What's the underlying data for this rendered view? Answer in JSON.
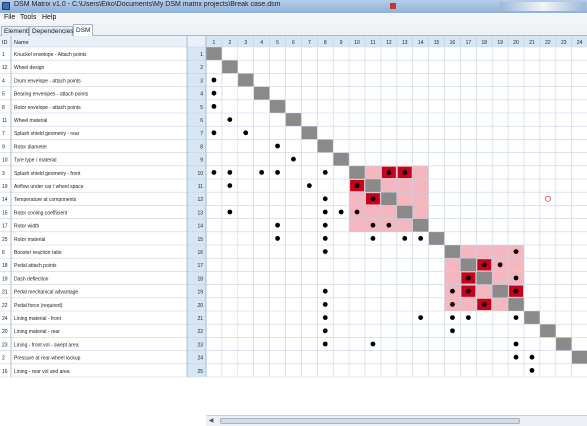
{
  "window": {
    "title": "DSM Matrix v1.0 - C:\\Users\\Eiko\\Documents\\My DSM matrix projects\\Break case.dsm"
  },
  "menu": [
    "File",
    "Tools",
    "Help"
  ],
  "tabs": [
    {
      "label": "Elements",
      "active": false
    },
    {
      "label": "Dependencies",
      "active": false
    },
    {
      "label": "DSM",
      "active": true
    }
  ],
  "table_header": {
    "id": "ID",
    "name": "Name"
  },
  "rows": [
    {
      "id": "1",
      "name": "Knuckel envelope - Attach points",
      "index": "1"
    },
    {
      "id": "12",
      "name": "Wheel design",
      "index": "2"
    },
    {
      "id": "4",
      "name": "Drum envelope - attach points",
      "index": "3"
    },
    {
      "id": "5",
      "name": "Bearing envelopes - attach points",
      "index": "4"
    },
    {
      "id": "8",
      "name": "Rotor envelope - attach points",
      "index": "5"
    },
    {
      "id": "11",
      "name": "Wheel material",
      "index": "6"
    },
    {
      "id": "7",
      "name": "Splash shield geometry - rear",
      "index": "7"
    },
    {
      "id": "9",
      "name": "Rotor diameter",
      "index": "8"
    },
    {
      "id": "10",
      "name": "Tyre type / material",
      "index": "9"
    },
    {
      "id": "3",
      "name": "Splash shield geometry - front",
      "index": "10"
    },
    {
      "id": "19",
      "name": "Airflow under car / wheel space",
      "index": "11"
    },
    {
      "id": "14",
      "name": "Temperature at components",
      "index": "12"
    },
    {
      "id": "15",
      "name": "Rotor cooling coefficient",
      "index": "13"
    },
    {
      "id": "17",
      "name": "Rotor width",
      "index": "14"
    },
    {
      "id": "25",
      "name": "Rotor material",
      "index": "15"
    },
    {
      "id": "6",
      "name": "Booster reaction ratio",
      "index": "16"
    },
    {
      "id": "18",
      "name": "Pedal attach points",
      "index": "17"
    },
    {
      "id": "19",
      "name": "Dash deflection",
      "index": "18"
    },
    {
      "id": "21",
      "name": "Pedal mechanical advantage",
      "index": "19"
    },
    {
      "id": "22",
      "name": "Pedal force (required)",
      "index": "20"
    },
    {
      "id": "24",
      "name": "Lining material - front",
      "index": "21"
    },
    {
      "id": "20",
      "name": "Lining material - rear",
      "index": "22"
    },
    {
      "id": "23",
      "name": "Lining - front vol - swept area",
      "index": "23"
    },
    {
      "id": "2",
      "name": "Pressure at rear-wheel lockup",
      "index": "24"
    },
    {
      "id": "16",
      "name": "Lining - rear vol and area",
      "index": "25"
    }
  ],
  "column_headers": [
    "1",
    "2",
    "3",
    "4",
    "5",
    "6",
    "7",
    "8",
    "9",
    "10",
    "11",
    "12",
    "13",
    "14",
    "15",
    "16",
    "17",
    "18",
    "19",
    "20",
    "21",
    "22",
    "23",
    "24"
  ],
  "matrix": {
    "dependencies": [
      [
        3,
        1
      ],
      [
        4,
        1
      ],
      [
        5,
        1
      ],
      [
        6,
        2
      ],
      [
        7,
        1
      ],
      [
        7,
        3
      ],
      [
        8,
        5
      ],
      [
        9,
        6
      ],
      [
        10,
        1
      ],
      [
        10,
        2
      ],
      [
        10,
        4
      ],
      [
        10,
        5
      ],
      [
        10,
        8
      ],
      [
        11,
        2
      ],
      [
        11,
        7
      ],
      [
        12,
        8
      ],
      [
        13,
        2
      ],
      [
        13,
        8
      ],
      [
        13,
        9
      ],
      [
        14,
        5
      ],
      [
        14,
        8
      ],
      [
        15,
        5
      ],
      [
        15,
        8
      ],
      [
        16,
        8
      ],
      [
        19,
        8
      ],
      [
        20,
        8
      ],
      [
        21,
        8
      ],
      [
        21,
        14
      ],
      [
        22,
        8
      ],
      [
        23,
        8
      ],
      [
        23,
        11
      ],
      [
        24,
        21
      ],
      [
        25,
        21
      ],
      [
        12,
        11
      ],
      [
        14,
        11
      ],
      [
        15,
        11
      ],
      [
        15,
        13
      ],
      [
        14,
        12
      ],
      [
        15,
        14
      ],
      [
        13,
        10
      ],
      [
        19,
        16
      ],
      [
        19,
        19
      ],
      [
        20,
        16
      ],
      [
        21,
        16
      ],
      [
        22,
        16
      ],
      [
        21,
        20
      ],
      [
        23,
        20
      ],
      [
        24,
        21
      ],
      [
        21,
        17
      ],
      [
        24,
        20
      ],
      [
        17,
        19
      ],
      [
        16,
        20
      ],
      [
        18,
        20
      ]
    ],
    "highlighted_dependencies": [
      [
        10,
        12
      ],
      [
        10,
        13
      ],
      [
        11,
        10
      ],
      [
        12,
        11
      ],
      [
        14,
        14
      ],
      [
        18,
        17
      ],
      [
        19,
        17
      ],
      [
        17,
        18
      ],
      [
        20,
        18
      ],
      [
        19,
        20
      ]
    ],
    "partitions": [
      {
        "start": 10,
        "end": 14
      },
      {
        "start": 16,
        "end": 20
      }
    ],
    "selected_cell": [
      12,
      22
    ],
    "colors": {
      "diagonal": "#8a8a8a",
      "partition": "#f4b6bf",
      "highlight": "#c8001a",
      "dot": "#000000",
      "header_fill": "#d7e6f5",
      "selected": "#e0473f"
    }
  }
}
